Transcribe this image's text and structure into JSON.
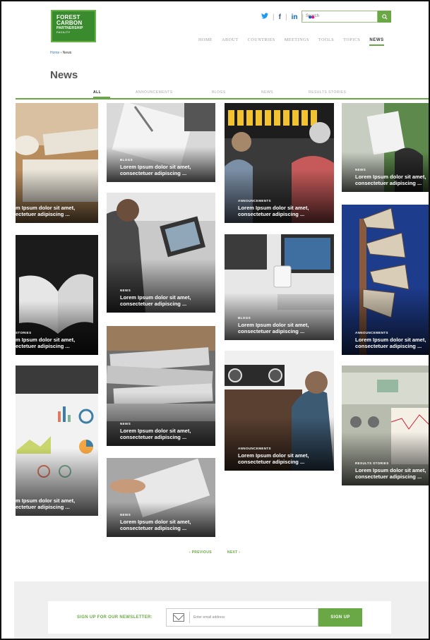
{
  "header": {
    "logo_lines": [
      "FOREST",
      "CARBON",
      "PARTNERSHIP",
      "FACILITY"
    ],
    "social": {
      "twitter": "🐦",
      "facebook": "f",
      "linkedin": "in",
      "flickr": "●●"
    },
    "search_placeholder": "Search",
    "nav": [
      "HOME",
      "ABOUT",
      "COUNTRIES",
      "MEETINGS",
      "TOOLS",
      "TOPICS",
      "NEWS"
    ],
    "nav_active": "NEWS"
  },
  "breadcrumb": {
    "home": "Home",
    "sep": " › ",
    "current": "News"
  },
  "page_title": "News",
  "filters": [
    "ALL",
    "ANNOUNCEMENTS",
    "BLOGS",
    "NEWS",
    "RESULTS STORIES"
  ],
  "filter_active": "ALL",
  "tiles": [
    {
      "category": "",
      "title_l1": "m Ipsum dolor sit amet,",
      "title_l2": "ectetuer adipiscing ..."
    },
    {
      "category": "STORIES",
      "title_l1": "m Ipsum dolor sit amet,",
      "title_l2": "ectetuer adipiscing ..."
    },
    {
      "category": "",
      "title_l1": "m Ipsum dolor sit amet,",
      "title_l2": "ectetuer adipiscing ..."
    },
    {
      "category": "BLOGS",
      "title_l1": "Lorem Ipsum dolor sit amet,",
      "title_l2": "consectetuer adipiscing ..."
    },
    {
      "category": "NEWS",
      "title_l1": "Lorem Ipsum dolor sit amet,",
      "title_l2": "consectetuer adipiscing ..."
    },
    {
      "category": "NEWS",
      "title_l1": "Lorem Ipsum dolor sit amet,",
      "title_l2": "consectetuer adipiscing ..."
    },
    {
      "category": "NEWS",
      "title_l1": "Lorem Ipsum dolor sit amet,",
      "title_l2": "consectetuer adipiscing ..."
    },
    {
      "category": "ANNOUNCEMENTS",
      "title_l1": "Lorem Ipsum dolor sit amet,",
      "title_l2": "consectetuer adipiscing ..."
    },
    {
      "category": "BLOGS",
      "title_l1": "Lorem Ipsum dolor sit amet,",
      "title_l2": "consectetuer adipiscing ..."
    },
    {
      "category": "ANNOUNCEMENTS",
      "title_l1": "Lorem Ipsum dolor sit amet,",
      "title_l2": "consectetuer adipiscing ..."
    },
    {
      "category": "NEWS",
      "title_l1": "Lorem Ipsum dolor sit amet,",
      "title_l2": "consectetuer adipiscing ..."
    },
    {
      "category": "ANNOUNCEMENTS",
      "title_l1": "Lorem Ipsum dolor sit amet,",
      "title_l2": "consectetuer adipiscing ..."
    },
    {
      "category": "RESULTS STORIES",
      "title_l1": "Lorem Ipsum dolor sit amet,",
      "title_l2": "consectetuer adipiscing ..."
    }
  ],
  "pager": {
    "previous": "‹ PREVIOUS",
    "next": "NEXT ›"
  },
  "newsletter": {
    "label": "SIGN UP FOR OUR NEWSLETTER:",
    "placeholder": "Enter email address",
    "button": "SIGN UP"
  },
  "colors": {
    "accent": "#6aa845",
    "brand": "#3a8a2e",
    "link": "#3a7fc2"
  }
}
